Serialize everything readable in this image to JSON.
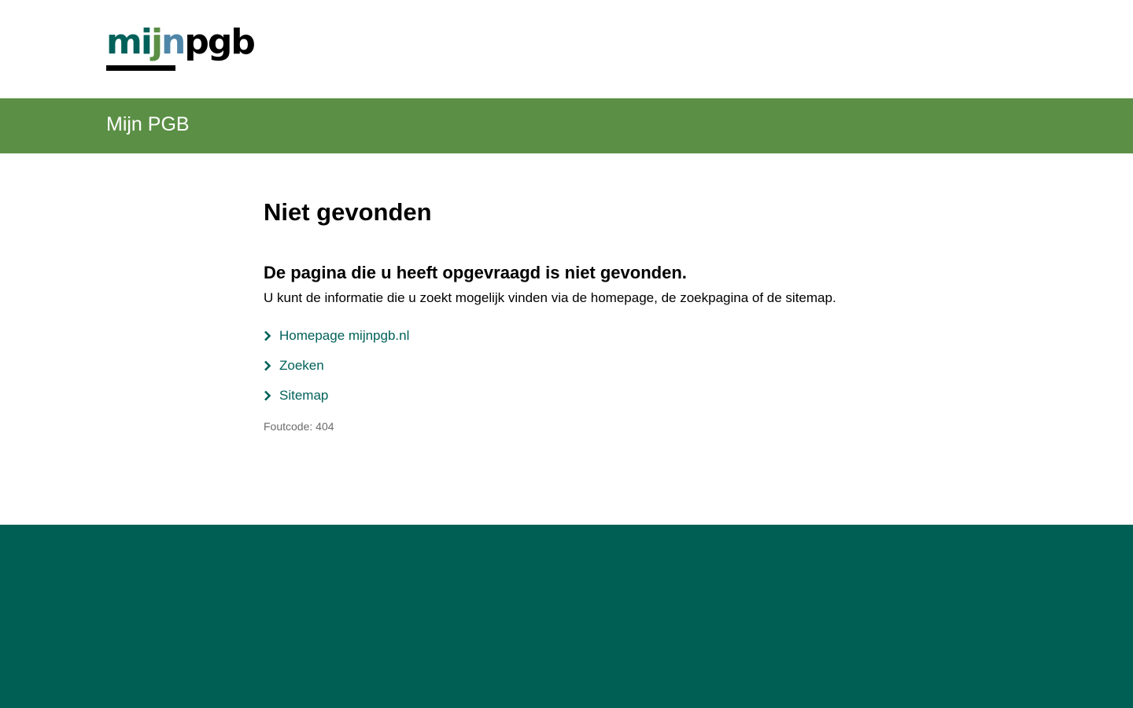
{
  "header": {
    "logo": {
      "part1": "mi",
      "part2": "j",
      "part3": "n",
      "part4": "pgb",
      "colors": {
        "primary": "#01615A",
        "accent_green": "#5B8F45",
        "accent_blue": "#4F86A8",
        "dark": "#000000"
      }
    }
  },
  "banner": {
    "title": "Mijn PGB",
    "color": "#5B8F45"
  },
  "main": {
    "title": "Niet gevonden",
    "subheading": "De pagina die u heeft opgevraagd is niet gevonden.",
    "intro": "U kunt de informatie die u zoekt mogelijk vinden via de homepage, de zoekpagina of de sitemap.",
    "links": [
      {
        "label": "Homepage mijnpgb.nl",
        "icon": "chevron-right-icon"
      },
      {
        "label": "Zoeken",
        "icon": "chevron-right-icon"
      },
      {
        "label": "Sitemap",
        "icon": "chevron-right-icon"
      }
    ],
    "error_code": "Foutcode: 404",
    "link_color": "#01615A"
  },
  "footer": {
    "color": "#005F55"
  }
}
